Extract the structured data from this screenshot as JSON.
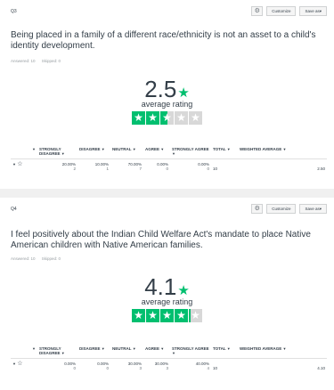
{
  "toolbar": {
    "customize_label": "Customize",
    "save_label": "Save as▾"
  },
  "questions": [
    {
      "id": "Q3",
      "title": "Being placed in a family of a different race/ethnicity is not an asset to a child's identity development.",
      "answered": "Answered: 10",
      "skipped": "Skipped: 0",
      "rating": "2.5",
      "rating_value": 2.5,
      "rating_label": "average rating",
      "columns": [
        "STRONGLY DISAGREE",
        "DISAGREE",
        "NEUTRAL",
        "AGREE",
        "STRONGLY AGREE",
        "TOTAL",
        "WEIGHTED AVERAGE"
      ],
      "row": {
        "pcts": [
          "20.00%",
          "10.00%",
          "70.00%",
          "0.00%",
          "0.00%"
        ],
        "counts": [
          "2",
          "1",
          "7",
          "0",
          "0"
        ],
        "total": "10",
        "weighted": "2.50"
      }
    },
    {
      "id": "Q4",
      "title": "I feel positively about the Indian Child Welfare Act's mandate to place Native American children with Native American families.",
      "answered": "Answered: 10",
      "skipped": "Skipped: 0",
      "rating": "4.1",
      "rating_value": 4.1,
      "rating_label": "average rating",
      "columns": [
        "STRONGLY DISAGREE",
        "DISAGREE",
        "NEUTRAL",
        "AGREE",
        "STRONGLY AGREE",
        "TOTAL",
        "WEIGHTED AVERAGE"
      ],
      "row": {
        "pcts": [
          "0.00%",
          "0.00%",
          "30.00%",
          "30.00%",
          "40.00%"
        ],
        "counts": [
          "0",
          "0",
          "3",
          "3",
          "4"
        ],
        "total": "10",
        "weighted": "4.10"
      }
    }
  ],
  "colors": {
    "accent": "#00bf6f",
    "empty_star": "#d8d8d8",
    "text": "#333e48"
  },
  "icons": {
    "chart_settings": "gear-icon",
    "row_star": "star-outline-icon"
  }
}
